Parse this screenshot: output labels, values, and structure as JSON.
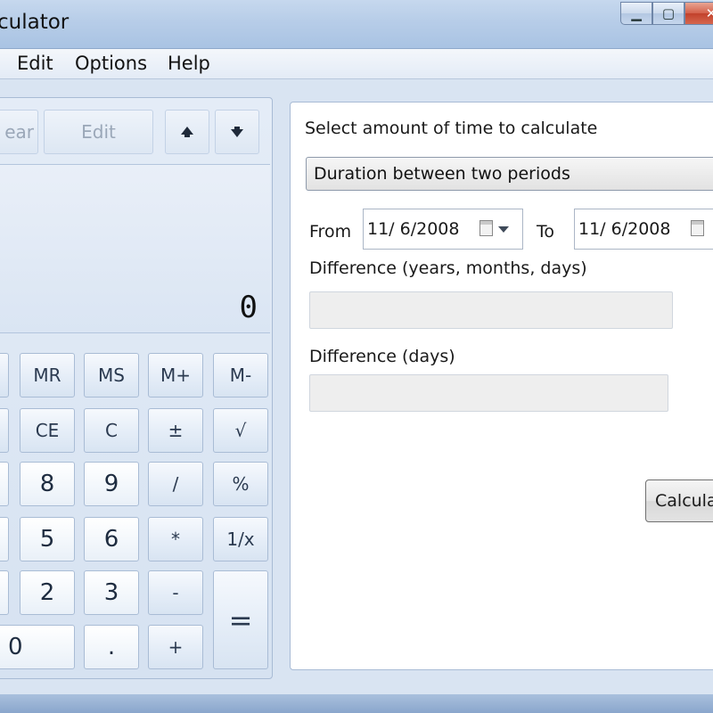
{
  "window": {
    "title": "culator",
    "buttons": {
      "minimize": "▁",
      "maximize": "▢",
      "close": "✕"
    }
  },
  "menu": [
    "Edit",
    "Options",
    "Help"
  ],
  "toolbar": {
    "clear_label": "ear",
    "edit_label": "Edit",
    "up_icon": "arrow-up-icon",
    "down_icon": "arrow-down-icon"
  },
  "display": {
    "value": "0"
  },
  "keypad": {
    "row1": [
      "MR",
      "MS",
      "M+",
      "M-"
    ],
    "row2": [
      "CE",
      "C",
      "±",
      "√"
    ],
    "row3": [
      "8",
      "9",
      "/",
      "%"
    ],
    "row4": [
      "5",
      "6",
      "*",
      "1/x"
    ],
    "row5": [
      "2",
      "3",
      "-"
    ],
    "row6": [
      "0",
      ".",
      "+"
    ],
    "equals": "="
  },
  "date_calc": {
    "select_label": "Select amount of time to calculate",
    "mode_value": "Duration between two periods",
    "from_label": "From",
    "from_value": "11/ 6/2008",
    "to_label": "To",
    "to_value": "11/ 6/2008",
    "diff_ymd_label": "Difference (years, months, days)",
    "diff_days_label": "Difference (days)",
    "calculate_label": "Calculate"
  },
  "colors": {
    "titlebar": "#b7cde8",
    "panel": "#d9e4f2",
    "close_button": "#c2412b"
  }
}
